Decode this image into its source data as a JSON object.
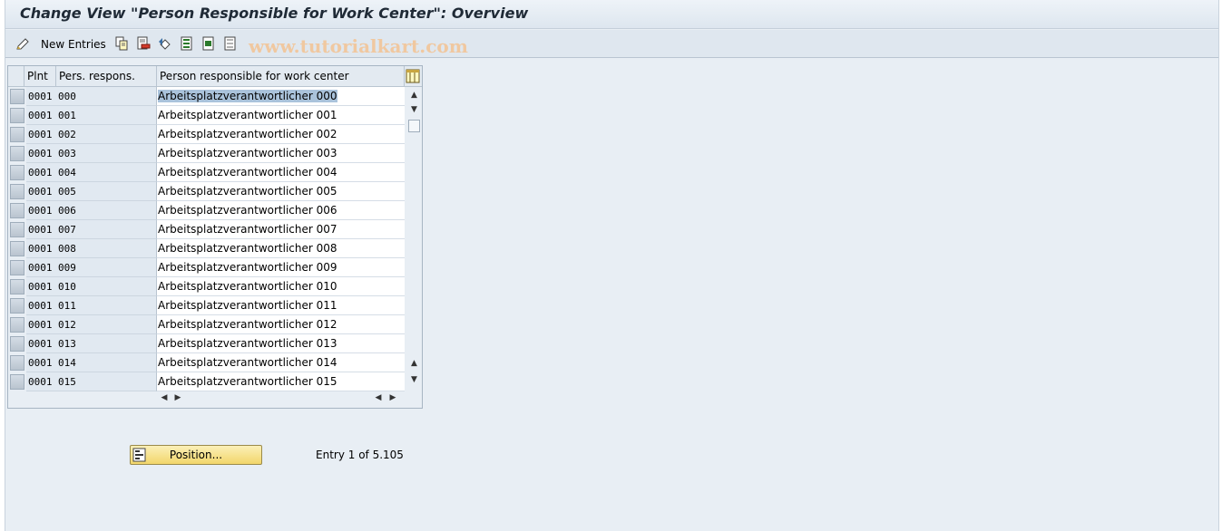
{
  "window": {
    "title": "Change View \"Person Responsible for Work Center\": Overview"
  },
  "toolbar": {
    "new_entries_label": "New Entries",
    "watermark": "www.tutorialkart.com",
    "icons": [
      "edit-icon",
      "copy-icon",
      "delete-icon",
      "undo-icon",
      "select-all-icon",
      "select-block-icon",
      "deselect-all-icon"
    ]
  },
  "table": {
    "headers": {
      "plnt": "Plnt",
      "pers": "Pers. respons.",
      "name": "Person responsible for work center"
    },
    "rows": [
      {
        "plnt": "0001",
        "pers": "000",
        "name": "Arbeitsplatzverantwortlicher 000"
      },
      {
        "plnt": "0001",
        "pers": "001",
        "name": "Arbeitsplatzverantwortlicher 001"
      },
      {
        "plnt": "0001",
        "pers": "002",
        "name": "Arbeitsplatzverantwortlicher 002"
      },
      {
        "plnt": "0001",
        "pers": "003",
        "name": "Arbeitsplatzverantwortlicher 003"
      },
      {
        "plnt": "0001",
        "pers": "004",
        "name": "Arbeitsplatzverantwortlicher 004"
      },
      {
        "plnt": "0001",
        "pers": "005",
        "name": "Arbeitsplatzverantwortlicher 005"
      },
      {
        "plnt": "0001",
        "pers": "006",
        "name": "Arbeitsplatzverantwortlicher 006"
      },
      {
        "plnt": "0001",
        "pers": "007",
        "name": "Arbeitsplatzverantwortlicher 007"
      },
      {
        "plnt": "0001",
        "pers": "008",
        "name": "Arbeitsplatzverantwortlicher 008"
      },
      {
        "plnt": "0001",
        "pers": "009",
        "name": "Arbeitsplatzverantwortlicher 009"
      },
      {
        "plnt": "0001",
        "pers": "010",
        "name": "Arbeitsplatzverantwortlicher 010"
      },
      {
        "plnt": "0001",
        "pers": "011",
        "name": "Arbeitsplatzverantwortlicher 011"
      },
      {
        "plnt": "0001",
        "pers": "012",
        "name": "Arbeitsplatzverantwortlicher 012"
      },
      {
        "plnt": "0001",
        "pers": "013",
        "name": "Arbeitsplatzverantwortlicher 013"
      },
      {
        "plnt": "0001",
        "pers": "014",
        "name": "Arbeitsplatzverantwortlicher 014"
      },
      {
        "plnt": "0001",
        "pers": "015",
        "name": "Arbeitsplatzverantwortlicher 015"
      }
    ],
    "selected_row": 0
  },
  "footer": {
    "position_label": "Position...",
    "entry_text": "Entry 1 of 5.105"
  },
  "colors": {
    "accent": "#f2d66a",
    "selection": "#aac3db",
    "background": "#e8eef4"
  }
}
